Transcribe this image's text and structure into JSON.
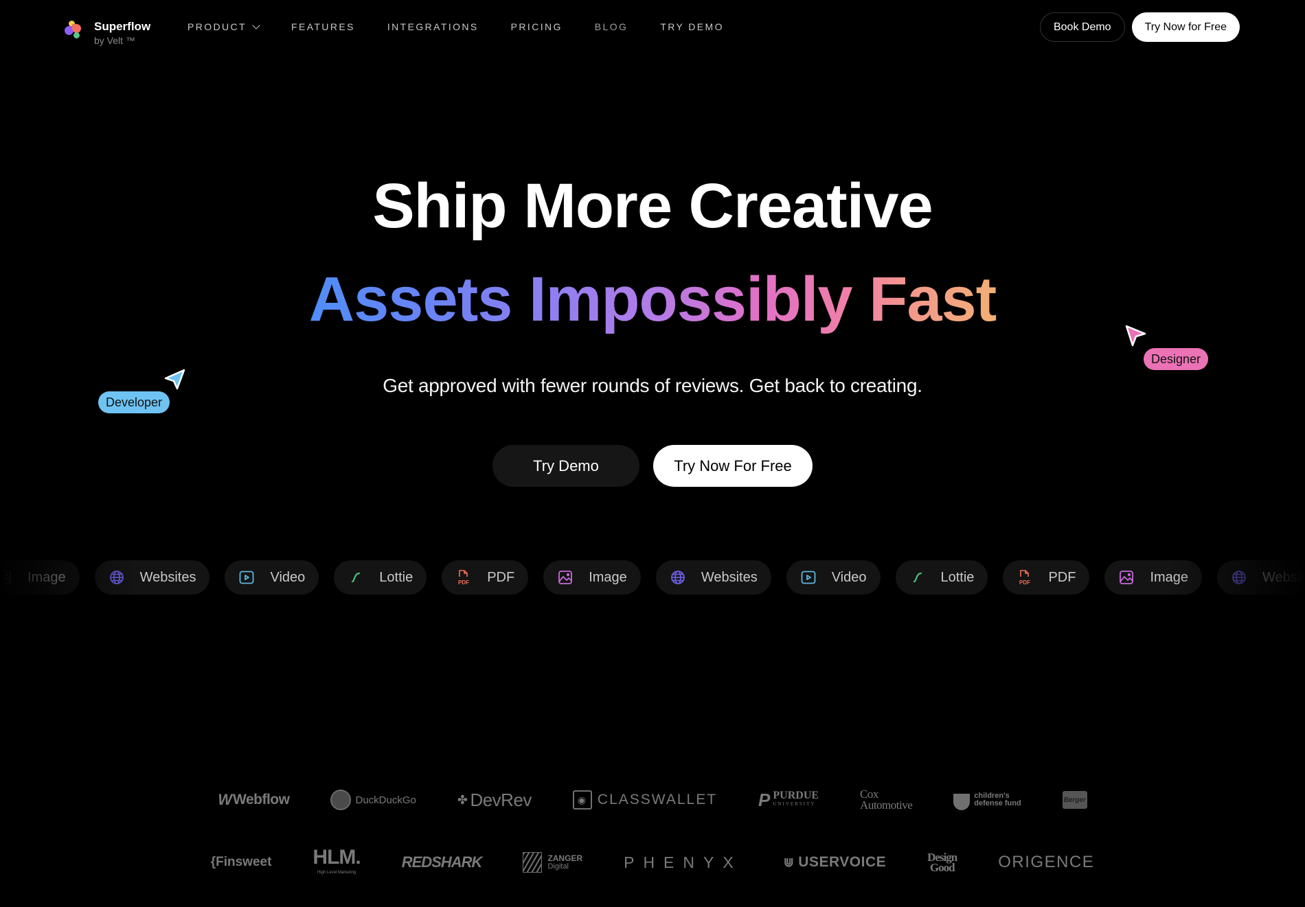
{
  "nav": {
    "brand_name": "Superflow",
    "brand_sub": "by Velt ™",
    "links": [
      {
        "label": "PRODUCT",
        "has_dropdown": true
      },
      {
        "label": "FEATURES"
      },
      {
        "label": "INTEGRATIONS"
      },
      {
        "label": "PRICING"
      },
      {
        "label": "BLOG"
      },
      {
        "label": "TRY DEMO"
      }
    ],
    "book_demo_label": "Book Demo",
    "try_now_label": "Try Now for Free"
  },
  "hero": {
    "line1": "Ship More Creative",
    "line2": "Assets Impossibly Fast",
    "subtitle": "Get approved with fewer rounds of reviews. Get back to creating.",
    "cta_primary": "Try Demo",
    "cta_secondary": "Try Now For Free",
    "gradient_colors": [
      "#4f8ef7",
      "#8f7ff0",
      "#e070c8",
      "#f2b074"
    ]
  },
  "cursors": [
    {
      "label": "Developer",
      "color": "#6ec3f2"
    },
    {
      "label": "Designer",
      "color": "#ec72b6"
    }
  ],
  "asset_pills": [
    {
      "label": "Image",
      "icon": "image-icon",
      "color": "#c86bd8"
    },
    {
      "label": "Websites",
      "icon": "globe-icon",
      "color": "#6b5fe0"
    },
    {
      "label": "Video",
      "icon": "play-icon",
      "color": "#5fb6e0"
    },
    {
      "label": "Lottie",
      "icon": "lottie-icon",
      "color": "#4cc07a"
    },
    {
      "label": "PDF",
      "icon": "pdf-icon",
      "color": "#f07057"
    },
    {
      "label": "Image",
      "icon": "image-icon",
      "color": "#c86bd8"
    },
    {
      "label": "Websites",
      "icon": "globe-icon",
      "color": "#6b5fe0"
    },
    {
      "label": "Video",
      "icon": "play-icon",
      "color": "#5fb6e0"
    },
    {
      "label": "Lottie",
      "icon": "lottie-icon",
      "color": "#4cc07a"
    },
    {
      "label": "PDF",
      "icon": "pdf-icon",
      "color": "#f07057"
    },
    {
      "label": "Image",
      "icon": "image-icon",
      "color": "#c86bd8"
    },
    {
      "label": "Websites",
      "icon": "globe-icon",
      "color": "#6b5fe0"
    }
  ],
  "logos": {
    "row1": {
      "webflow": "Webflow",
      "duckduckgo": "DuckDuckGo",
      "devrev": "DevRev",
      "classwallet": "CLASSWALLET",
      "purdue": "PURDUE",
      "purdue_sub": "UNIVERSITY",
      "cox_1": "Cox",
      "cox_2": "Automotive",
      "cdf_1": "children's",
      "cdf_2": "defense fund",
      "berger": "Berger"
    },
    "row2": {
      "finsweet": "{Finsweet",
      "hlm": "HLM.",
      "hlm_sub": "High Level Marketing",
      "redshark": "REDSHARK",
      "zanger_1": "ZANGER",
      "zanger_2": "Digital",
      "phenyx": "PHENYX",
      "uservoice": "USERVOICE",
      "design_1": "Design",
      "design_2": "Good",
      "origence": "ORIGENCE"
    }
  }
}
